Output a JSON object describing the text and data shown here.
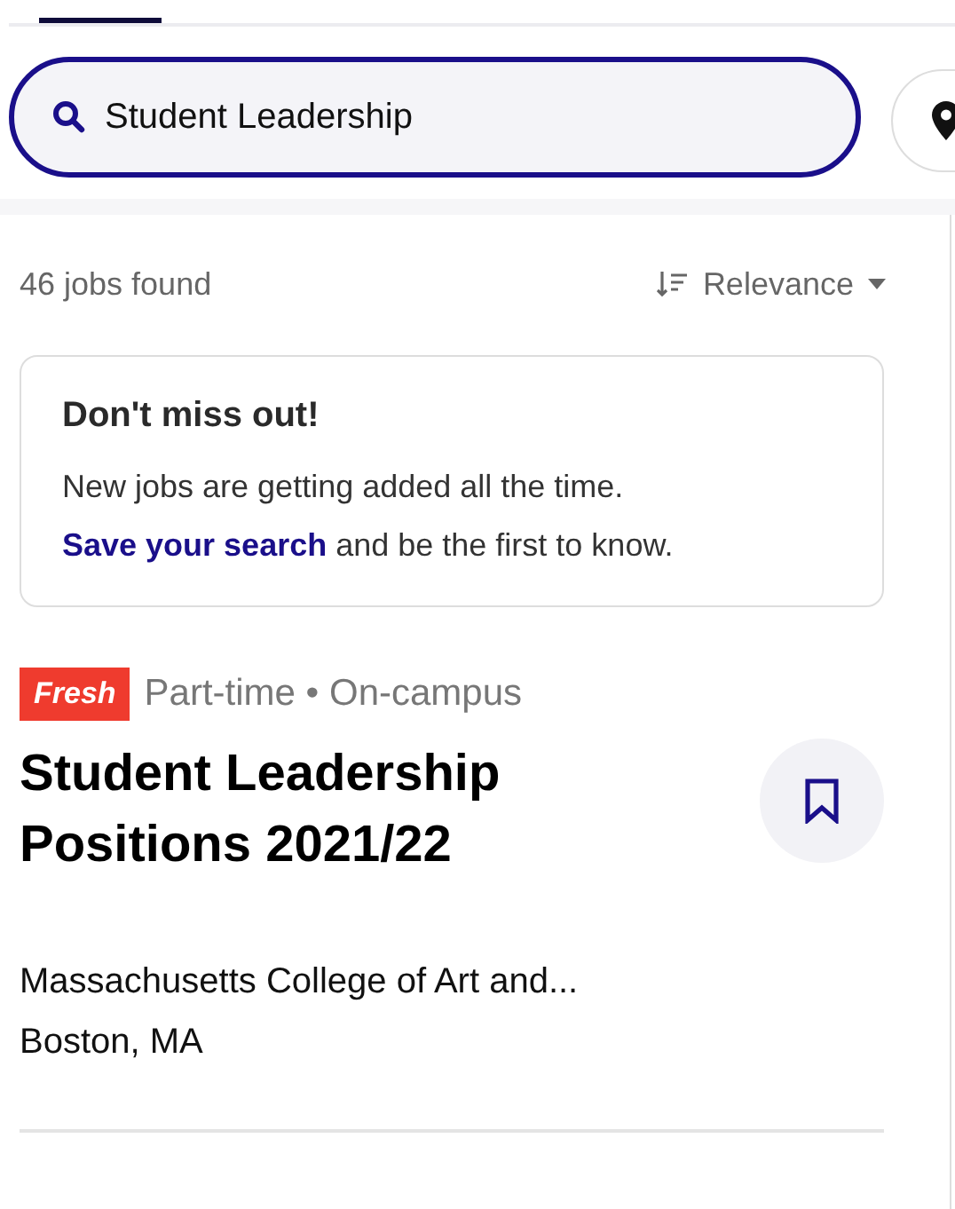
{
  "search": {
    "value": "Student Leadership"
  },
  "results": {
    "count": "46 jobs found",
    "sort": "Relevance"
  },
  "banner": {
    "title": "Don't miss out!",
    "text": "New jobs are getting added all the time.",
    "link": "Save your search",
    "link_rest": " and be the first to know."
  },
  "jobs": [
    {
      "badge": "Fresh",
      "tags": "Part-time • On-campus",
      "title": "Student Leadership Positions 2021/22",
      "employer": "Massachusetts College of Art and...",
      "location": "Boston, MA",
      "saved": false
    }
  ]
}
